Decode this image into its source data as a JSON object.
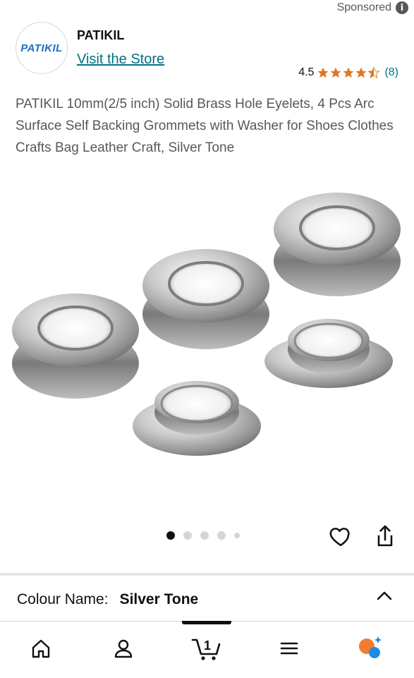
{
  "header": {
    "sponsored_label": "Sponsored",
    "info_icon": "i"
  },
  "brand": {
    "logo_text": "PATIKIL",
    "name": "PATIKIL",
    "visit_store": "Visit the Store"
  },
  "rating": {
    "value": "4.5",
    "stars": 4.5,
    "count": "(8)",
    "star_color": "#de7921"
  },
  "product": {
    "title": "PATIKIL 10mm(2/5 inch) Solid Brass Hole Eyelets, 4 Pcs Arc Surface Self Backing Grommets with Washer for Shoes Clothes Crafts Bag Leather Craft, Silver Tone"
  },
  "carousel": {
    "total_dots": 5,
    "active_index": 0
  },
  "variation": {
    "label": "Colour Name:",
    "value": "Silver Tone"
  },
  "bottom_nav": {
    "items": [
      "home-icon",
      "account-icon",
      "cart-icon",
      "menu-icon",
      "ai-assistant-icon"
    ],
    "cart_count": "1"
  },
  "colors": {
    "link": "#007185",
    "text": "#0f1111",
    "muted": "#565959"
  }
}
